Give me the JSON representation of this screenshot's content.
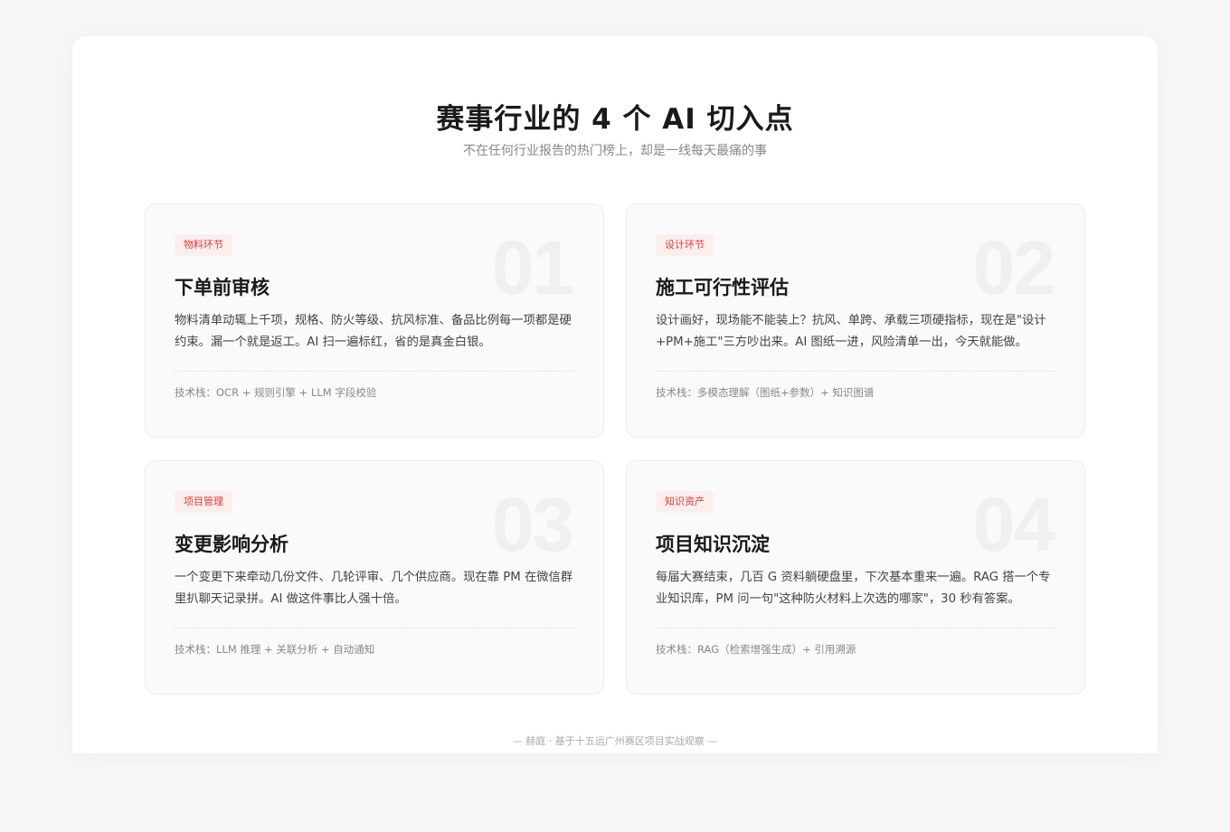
{
  "header": {
    "title": "赛事行业的 4 个 AI 切入点",
    "subtitle": "不在任何行业报告的热门榜上，却是一线每天最痛的事"
  },
  "cards": [
    {
      "tag": "物料环节",
      "number": "01",
      "title": "下单前审核",
      "description": "物料清单动辄上千项，规格、防火等级、抗风标准、备品比例每一项都是硬约束。漏一个就是返工。AI 扫一遍标红，省的是真金白银。",
      "tech": "技术栈：OCR + 规则引擎 + LLM 字段校验"
    },
    {
      "tag": "设计环节",
      "number": "02",
      "title": "施工可行性评估",
      "description": "设计画好，现场能不能装上？抗风、单跨、承载三项硬指标，现在是\"设计+PM+施工\"三方吵出来。AI 图纸一进，风险清单一出，今天就能做。",
      "tech": "技术栈：多模态理解（图纸+参数）+ 知识图谱"
    },
    {
      "tag": "项目管理",
      "number": "03",
      "title": "变更影响分析",
      "description": "一个变更下来牵动几份文件、几轮评审、几个供应商。现在靠 PM 在微信群里扒聊天记录拼。AI 做这件事比人强十倍。",
      "tech": "技术栈：LLM 推理 + 关联分析 + 自动通知"
    },
    {
      "tag": "知识资产",
      "number": "04",
      "title": "项目知识沉淀",
      "description": "每届大赛结束，几百 G 资料躺硬盘里，下次基本重来一遍。RAG 搭一个专业知识库，PM 问一句\"这种防火材料上次选的哪家\"，30 秒有答案。",
      "tech": "技术栈：RAG（检索增强生成）+ 引用溯源"
    }
  ],
  "footer": "— 赫庭 · 基于十五运广州赛区项目实战观察 —",
  "colors": {
    "accent": "#e53935",
    "tag_bg": "#fdeeee"
  }
}
